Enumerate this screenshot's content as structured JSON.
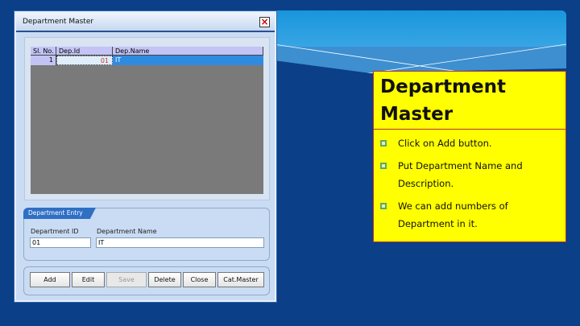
{
  "window": {
    "title": "Department Master"
  },
  "grid": {
    "columns": [
      "Sl. No.",
      "Dep.Id",
      "Dep.Name"
    ],
    "rows": [
      [
        "1",
        "01",
        "IT"
      ]
    ]
  },
  "entry": {
    "group_title": "Department Entry",
    "id_label": "Department ID",
    "name_label": "Department Name",
    "id_value": "01",
    "name_value": "IT"
  },
  "buttons": [
    {
      "label": "Add"
    },
    {
      "label": "Edit"
    },
    {
      "label": "Save",
      "disabled": true
    },
    {
      "label": "Delete"
    },
    {
      "label": "Close"
    },
    {
      "label": "Cat.Master"
    }
  ],
  "slide": {
    "title": "Department Master",
    "bullets": [
      "Click on Add button.",
      "Put Department Name and Description.",
      "We can add numbers of Department in it."
    ],
    "colors": {
      "background": "#0b3f88",
      "panel": "#ffff00",
      "border": "#b5332b"
    }
  }
}
